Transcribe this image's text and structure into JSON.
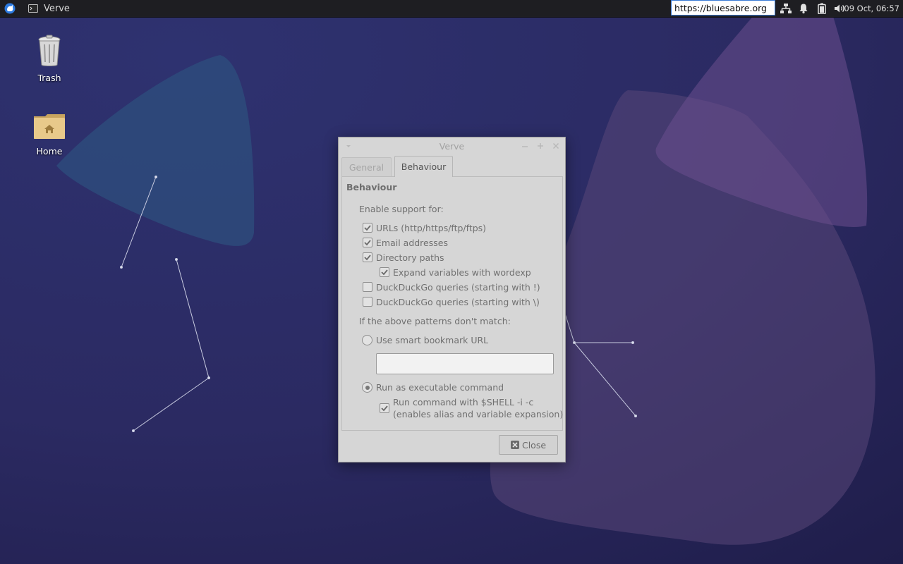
{
  "panel": {
    "menu_icon": "xfce-mouse-icon",
    "taskbar_app": {
      "icon": "terminal-icon",
      "label": "Verve"
    },
    "url_entry_value": "https://bluesabre.org",
    "tray_icons": [
      "network-icon",
      "bell-icon",
      "battery-icon",
      "volume-icon"
    ],
    "clock": "09 Oct, 06:57"
  },
  "desktop": {
    "icons": [
      {
        "name": "trash",
        "icon": "trash-icon",
        "label": "Trash"
      },
      {
        "name": "home",
        "icon": "home-folder-icon",
        "label": "Home"
      }
    ]
  },
  "dialog": {
    "title": "Verve",
    "tabs": [
      {
        "label": "General",
        "active": false
      },
      {
        "label": "Behaviour",
        "active": true
      }
    ],
    "section_title": "Behaviour",
    "enable_label": "Enable support for:",
    "options": [
      {
        "label": "URLs (http/https/ftp/ftps)",
        "checked": true
      },
      {
        "label": "Email addresses",
        "checked": true
      },
      {
        "label": "Directory paths",
        "checked": true
      },
      {
        "label": "Expand variables with wordexp",
        "checked": true
      },
      {
        "label": "DuckDuckGo queries (starting with !)",
        "checked": false
      },
      {
        "label": "DuckDuckGo queries (starting with \\)",
        "checked": false
      }
    ],
    "fallback_label": "If the above patterns don't match:",
    "smart_bookmark": {
      "label": "Use smart bookmark URL",
      "selected": false,
      "value": ""
    },
    "run_command": {
      "label": "Run as executable command",
      "selected": true
    },
    "shell_option": {
      "line1": "Run command with $SHELL -i -c",
      "line2": "(enables alias and variable expansion)",
      "checked": true
    },
    "close_label": "Close"
  },
  "colors": {
    "panel_bg": "#1e1e22",
    "wallpaper_bg": "#2a2a5a",
    "dialog_bg": "#d6d6d6",
    "url_entry_border": "#3a7bd5"
  }
}
